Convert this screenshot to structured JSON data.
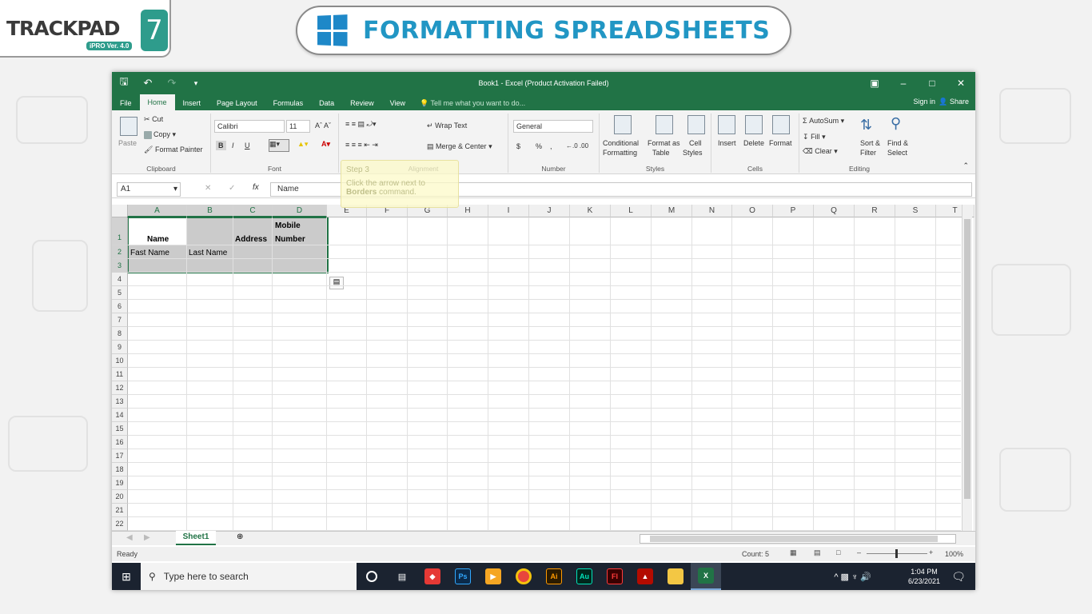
{
  "brand": {
    "name": "TRACKPAD",
    "version_badge": "iPRO Ver. 4.0",
    "edition": "7"
  },
  "lesson_title": "FORMATTING SPREADSHEETS",
  "window": {
    "title": "Book1 - Excel (Product Activation Failed)"
  },
  "menu": {
    "tabs": [
      "File",
      "Home",
      "Insert",
      "Page Layout",
      "Formulas",
      "Data",
      "Review",
      "View"
    ],
    "active": "Home",
    "tell_me": "Tell me what you want to do...",
    "signin": "Sign in",
    "share": "Share"
  },
  "ribbon": {
    "clipboard": {
      "paste": "Paste",
      "cut": "Cut",
      "copy": "Copy",
      "format_painter": "Format Painter",
      "label": "Clipboard"
    },
    "font": {
      "name": "Calibri",
      "size": "11",
      "bold": "B",
      "italic": "I",
      "underline": "U",
      "label": "Font"
    },
    "alignment": {
      "wrap": "Wrap Text",
      "merge": "Merge & Center",
      "label": "Alignment"
    },
    "number": {
      "format": "General",
      "currency": "$",
      "percent": "%",
      "comma": ",",
      "label": "Number"
    },
    "styles": {
      "conditional": "Conditional",
      "conditional2": "Formatting",
      "format_as": "Format as",
      "table": "Table",
      "cell": "Cell",
      "cell_styles": "Styles",
      "label": "Styles"
    },
    "cells": {
      "insert": "Insert",
      "delete": "Delete",
      "format": "Format",
      "label": "Cells"
    },
    "editing": {
      "autosum": "AutoSum",
      "fill": "Fill",
      "clear": "Clear",
      "sort": "Sort &",
      "filter": "Filter",
      "find": "Find &",
      "select": "Select",
      "label": "Editing"
    }
  },
  "tooltip": {
    "step": "Step 3",
    "line1": "Click the arrow next to",
    "bold": "Borders",
    "line2": " command."
  },
  "formula_bar": {
    "name_box": "A1",
    "fx": "fx",
    "value": "Name"
  },
  "columns": [
    "A",
    "B",
    "C",
    "D",
    "E",
    "F",
    "G",
    "H",
    "I",
    "J",
    "K",
    "L",
    "M",
    "N",
    "O",
    "P",
    "Q",
    "R",
    "S",
    "T"
  ],
  "rows": [
    "1",
    "2",
    "3",
    "4",
    "5",
    "6",
    "7",
    "8",
    "9",
    "10",
    "11",
    "12",
    "13",
    "14",
    "15",
    "16",
    "17",
    "18",
    "19",
    "20",
    "21",
    "22"
  ],
  "cells": {
    "a1": "Name",
    "c1": "Address",
    "d1_line1": "Mobile",
    "d1_line2": "Number",
    "a2": "Fast Name",
    "b2": "Last Name"
  },
  "sheet_tab": "Sheet1",
  "status": {
    "ready": "Ready",
    "count": "Count: 5",
    "zoom": "100%"
  },
  "taskbar": {
    "search": "Type here to search",
    "time": "1:04 PM",
    "date": "6/23/2021"
  }
}
